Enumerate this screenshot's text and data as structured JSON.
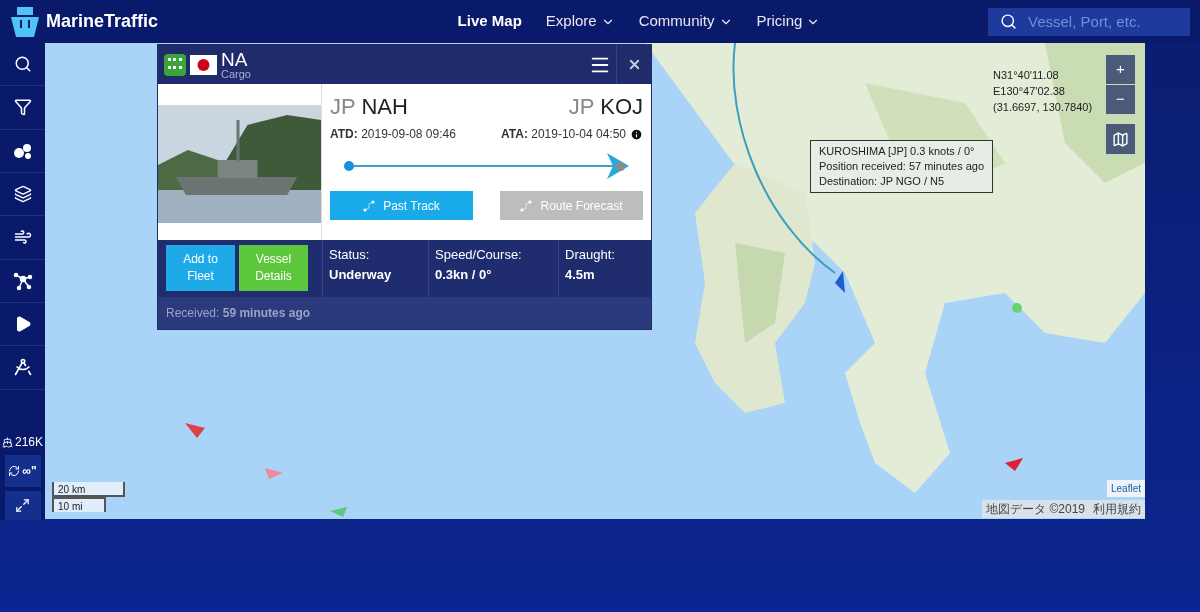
{
  "header": {
    "logo": "MarineTraffic",
    "nav": [
      {
        "label": "Live Map",
        "selected": true,
        "dropdown": false
      },
      {
        "label": "Explore",
        "selected": false,
        "dropdown": true
      },
      {
        "label": "Community",
        "selected": false,
        "dropdown": true
      },
      {
        "label": "Pricing",
        "selected": false,
        "dropdown": true
      }
    ],
    "search": {
      "placeholder": "Vessel, Port, etc."
    }
  },
  "sidebar": {
    "vessel_count": "216K",
    "refresh": "∞\""
  },
  "popup": {
    "name": "NA",
    "type": "Cargo",
    "origin": {
      "country": "JP",
      "port": "NAH"
    },
    "destination": {
      "country": "JP",
      "port": "KOJ"
    },
    "atd": {
      "label": "ATD:",
      "value": "2019-09-08 09:46"
    },
    "ata": {
      "label": "ATA:",
      "value": "2019-10-04 04:50"
    },
    "progress": {
      "level": 0.97
    },
    "track_buttons": [
      {
        "label": "Past Track",
        "disabled": false
      },
      {
        "label": "Route Forecast",
        "disabled": true
      }
    ],
    "actions": [
      {
        "label": "Add to Fleet",
        "kind": "blue"
      },
      {
        "label": "Vessel Details",
        "kind": "green"
      }
    ],
    "stats": [
      {
        "label": "Status:",
        "value": "Underway"
      },
      {
        "label": "Speed/Course:",
        "value": "0.3kn / 0°"
      },
      {
        "label": "Draught:",
        "value": "4.5m"
      }
    ],
    "received": "Received: **59 minutes ago**"
  },
  "tooltip": {
    "lines": [
      "KUROSHIMA [JP] 0.3 knots / 0°",
      "Position received: 57 minutes ago",
      "Destination: JP NGO / N5"
    ]
  },
  "coordinates": [
    "N31°40'11.08",
    "E130°47'02.38",
    "(31.6697, 130.7840)"
  ],
  "zoom": [
    "+",
    "−"
  ],
  "scale": [
    "20 km",
    "10 mi"
  ],
  "attribution": {
    "leaflet": "Leaflet",
    "map_data": "地図データ ©2019",
    "terms": "利用規約"
  }
}
